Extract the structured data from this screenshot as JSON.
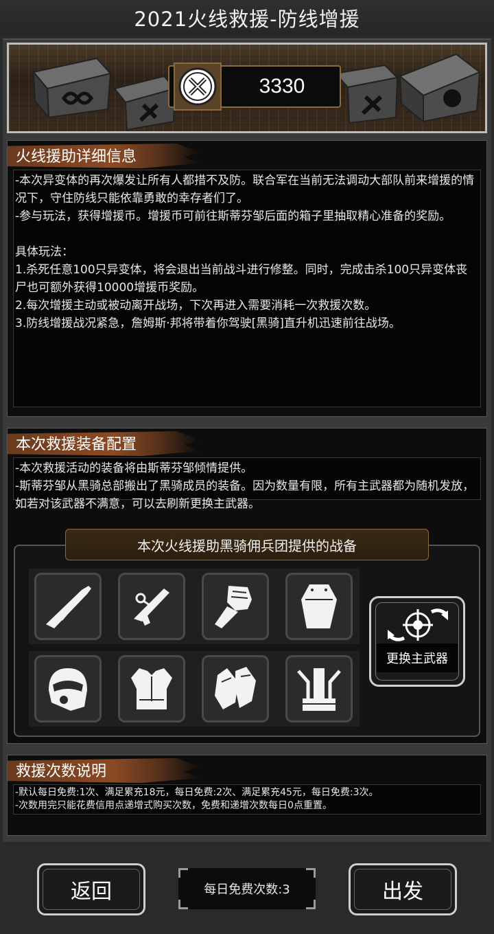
{
  "title": "2021火线救援-防线增援",
  "banner": {
    "coin_value": "3330"
  },
  "info": {
    "header": "火线援助详细信息",
    "body": "-本次异变体的再次爆发让所有人都措不及防。联合军在当前无法调动大部队前来增援的情况下，守住防线只能依靠勇敢的幸存者们了。\n-参与玩法，获得增援币。增援币可前往斯蒂芬邹后面的箱子里抽取精心准备的奖励。\n\n具体玩法：\n1.杀死任意100只异变体，将会退出当前战斗进行修整。同时，完成击杀100只异变体丧尸也可额外获得10000增援币奖励。\n2.每次增援主动或被动离开战场，下次再进入需要消耗一次救援次数。\n3.防线增援战况紧急，詹姆斯·邦将带着你驾驶[黑骑]直升机迅速前往战场。"
  },
  "equip_config": {
    "header": "本次救援装备配置",
    "body": "-本次救援活动的装备将由斯蒂芬邹倾情提供。\n-斯蒂芬邹从黑骑总部搬出了黑骑成员的装备。因为数量有限，所有主武器都为随机发放，如若对该武器不满意，可以去刷新更换主武器。",
    "panel_title": "本次火线援助黑骑佣兵团提供的战备",
    "swap_label": "更换主武器",
    "slots": [
      "rifle-icon",
      "pistol-icon",
      "fist-icon",
      "armor-plate-icon",
      "helmet-icon",
      "body-armor-icon",
      "gloves-icon",
      "backpack-rig-icon"
    ]
  },
  "rescue": {
    "header": "救援次数说明",
    "body": "-默认每日免费:1次、满足累充18元，每日免费:2次、满足累充45元，每日免费:3次。\n-次数用完只能花费信用点递增式购买次数，免费和递增次数每日0点重置。"
  },
  "footer": {
    "back_label": "返回",
    "daily_free": "每日免费次数:3",
    "depart_label": "出发"
  }
}
